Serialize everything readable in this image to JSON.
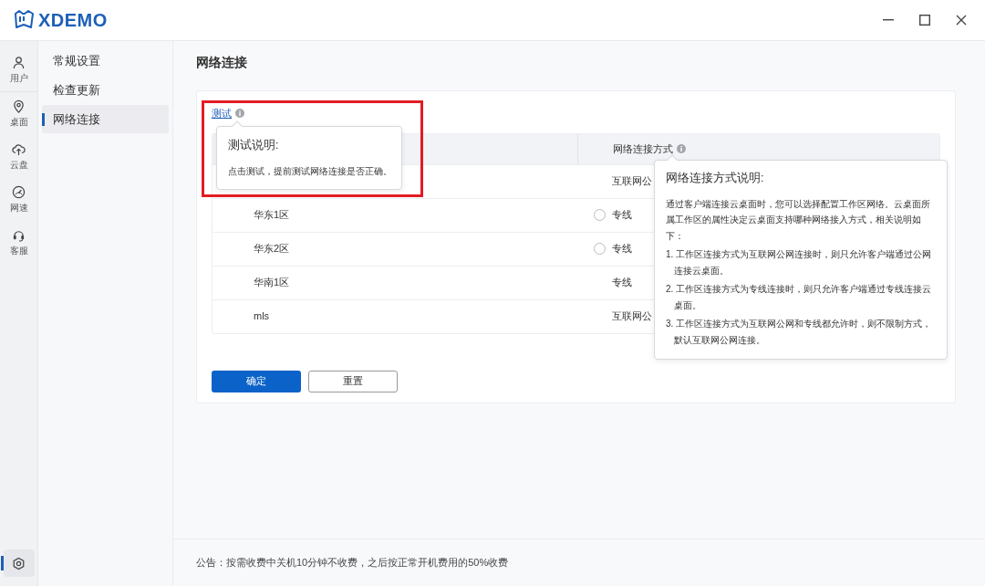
{
  "app": {
    "logo_text": "XDEMO"
  },
  "rail": [
    {
      "label": "用户",
      "selected": false
    },
    {
      "label": "桌面",
      "selected": false
    },
    {
      "label": "云盘",
      "selected": false
    },
    {
      "label": "网速",
      "selected": false
    },
    {
      "label": "客服",
      "selected": false
    }
  ],
  "rail_bottom": {
    "selected": true
  },
  "sidebar": [
    {
      "label": "常规设置",
      "selected": false
    },
    {
      "label": "检查更新",
      "selected": false
    },
    {
      "label": "网络连接",
      "selected": true
    }
  ],
  "page_title": "网络连接",
  "test_link": "测试",
  "test_tooltip": {
    "title": "测试说明:",
    "body": "点击测试，提前测试网络连接是否正确。",
    "highlighted": true
  },
  "table": {
    "method_header": "网络连接方式",
    "rows": [
      {
        "kind": "plain",
        "method": "互联网公"
      },
      {
        "kind": "radio",
        "selected": false,
        "region": "华东1区",
        "method": "专线"
      },
      {
        "kind": "radio",
        "selected": false,
        "region": "华东2区",
        "method": "专线"
      },
      {
        "kind": "plain",
        "region": "华南1区",
        "method": "专线"
      },
      {
        "kind": "plain",
        "region": "mls",
        "method": "互联网公"
      }
    ]
  },
  "method_tooltip": {
    "title": "网络连接方式说明:",
    "intro": "通过客户端连接云桌面时，您可以选择配置工作区网络。云桌面所属工作区的属性决定云桌面支持哪种网络接入方式，相关说明如下：",
    "items": [
      "1. 工作区连接方式为互联网公网连接时，则只允许客户端通过公网连接云桌面。",
      "2. 工作区连接方式为专线连接时，则只允许客户端通过专线连接云桌面。",
      "3. 工作区连接方式为互联网公网和专线都允许时，则不限制方式，默认互联网公网连接。"
    ]
  },
  "buttons": [
    {
      "label": "确定",
      "kind": "primary"
    },
    {
      "label": "重置",
      "kind": "outline"
    }
  ],
  "notice": "公告：按需收费中关机10分钟不收费，之后按正常开机费用的50%收费"
}
